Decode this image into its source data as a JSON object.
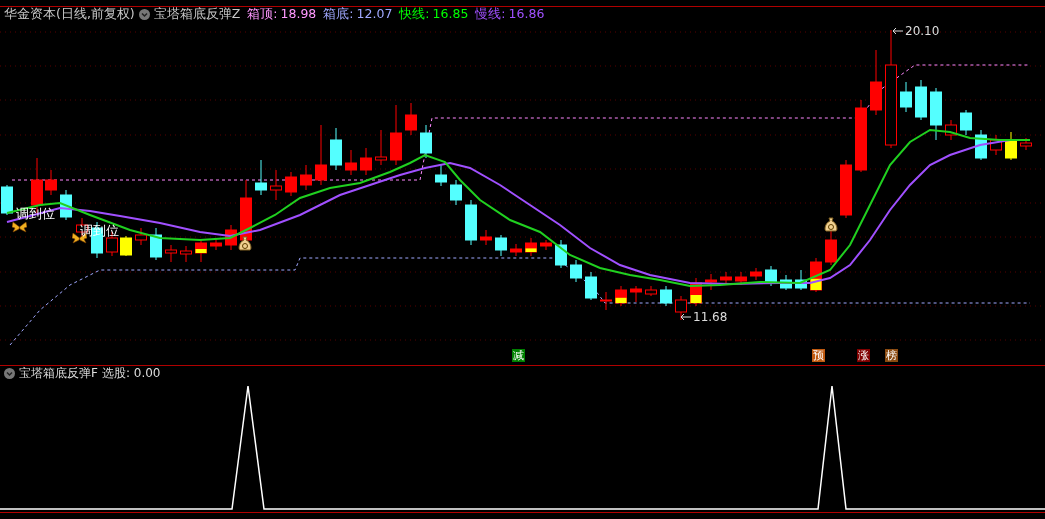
{
  "header": {
    "title": "华金资本(日线,前复权)",
    "indicator": "宝塔箱底反弹Z",
    "readings": [
      {
        "label": "箱顶:",
        "value": "18.98",
        "color": "#ff99ff"
      },
      {
        "label": "箱底:",
        "value": "12.07",
        "color": "#a0a8ff"
      },
      {
        "label": "快线:",
        "value": "16.85",
        "color": "#00ff00"
      },
      {
        "label": "慢线:",
        "value": "16.86",
        "color": "#a050ff"
      }
    ]
  },
  "chart_labels": [
    "调到位",
    "调到位"
  ],
  "price_marks": [
    {
      "kind": "high",
      "text": "20.10"
    },
    {
      "kind": "low",
      "text": "11.68"
    }
  ],
  "signals": [
    {
      "text": "减",
      "color": "#008000"
    },
    {
      "text": "预",
      "color": "#c05a10"
    },
    {
      "text": "涨",
      "color": "#800000"
    },
    {
      "text": "榜",
      "color": "#8a4a10"
    }
  ],
  "sub_panel": {
    "title": "宝塔箱底反弹F",
    "reading": "选股: 0.00"
  }
}
